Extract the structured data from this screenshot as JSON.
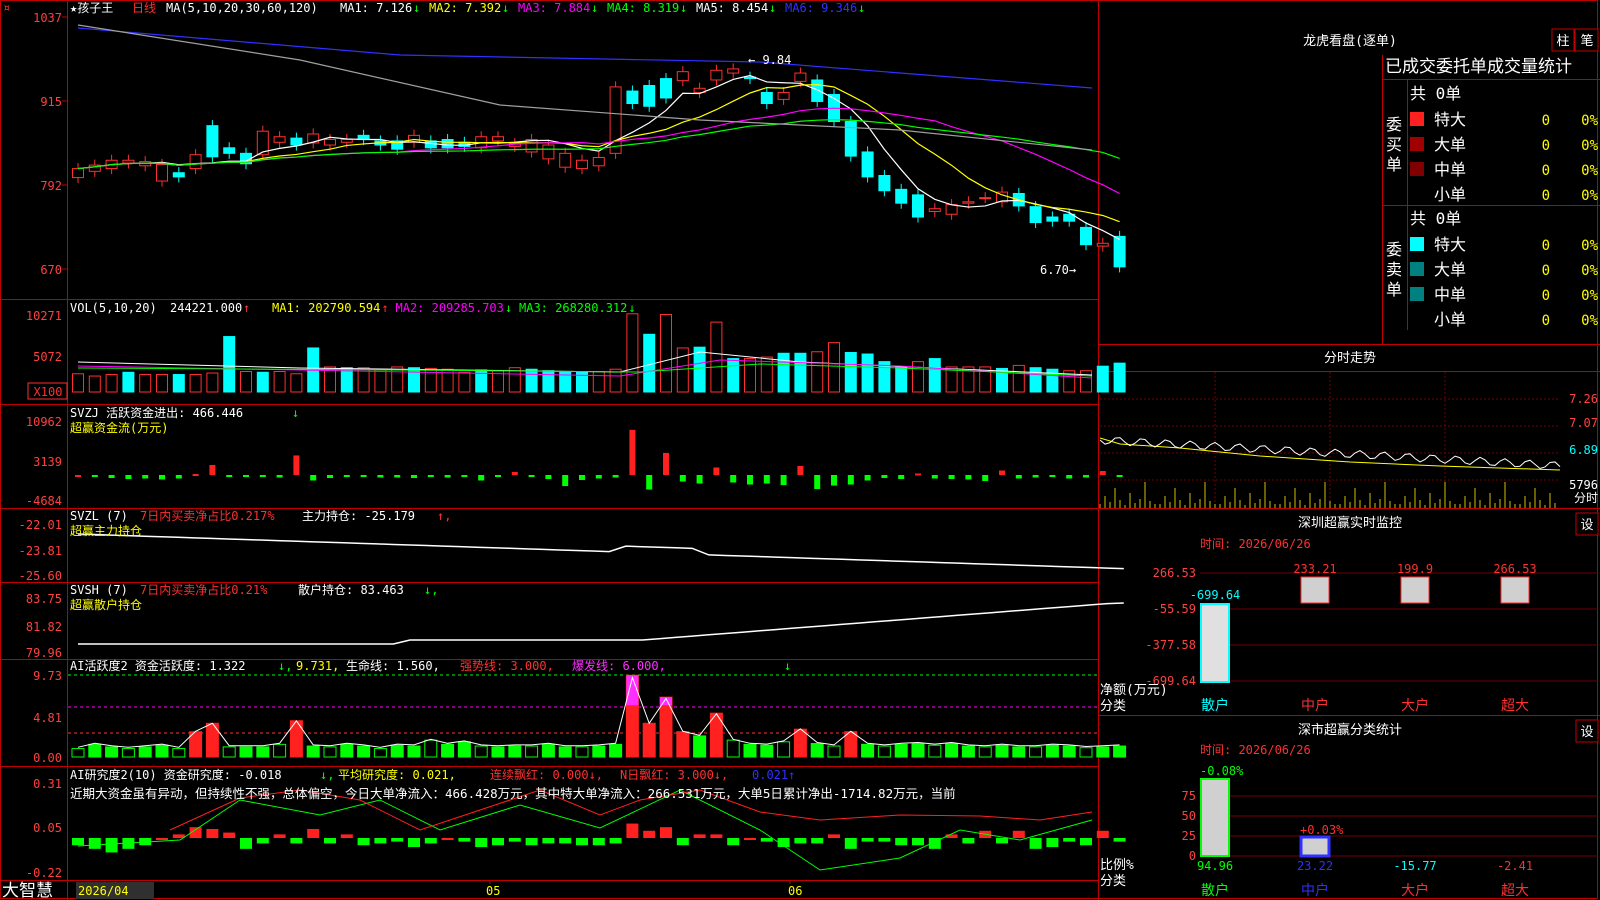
{
  "chart_data": [
    {
      "type": "candlestick",
      "title": "孩子王日线",
      "indicator": "MA(5,10,20,30,60,120)",
      "y_ticks": [
        "1037",
        "915",
        "792",
        "670"
      ],
      "ylim": [
        640,
        1040
      ],
      "ma_values": [
        {
          "name": "MA1",
          "value": "7.126",
          "arrow": "↓"
        },
        {
          "name": "MA2",
          "value": "7.392",
          "arrow": "↓"
        },
        {
          "name": "MA3",
          "value": "7.884",
          "arrow": "↓"
        },
        {
          "name": "MA4",
          "value": "8.319",
          "arrow": "↓"
        },
        {
          "name": "MA5",
          "value": "8.454",
          "arrow": "↓"
        },
        {
          "name": "MA6",
          "value": "9.346",
          "arrow": "↓"
        }
      ],
      "annotations": [
        "9.84",
        "6.70"
      ],
      "candles": [
        [
          805,
          818
        ],
        [
          814,
          823
        ],
        [
          818,
          830
        ],
        [
          826,
          830
        ],
        [
          822,
          828
        ],
        [
          800,
          824
        ],
        [
          812,
          806
        ],
        [
          818,
          838
        ],
        [
          880,
          835
        ],
        [
          848,
          840
        ],
        [
          840,
          825
        ],
        [
          838,
          872
        ],
        [
          856,
          864
        ],
        [
          862,
          852
        ],
        [
          855,
          868
        ],
        [
          852,
          860
        ],
        [
          856,
          860
        ],
        [
          866,
          860
        ],
        [
          858,
          852
        ],
        [
          858,
          846
        ],
        [
          856,
          866
        ],
        [
          858,
          848
        ],
        [
          860,
          848
        ],
        [
          856,
          850
        ],
        [
          848,
          864
        ],
        [
          858,
          864
        ],
        [
          850,
          854
        ],
        [
          842,
          860
        ],
        [
          832,
          852
        ],
        [
          820,
          840
        ],
        [
          818,
          830
        ],
        [
          822,
          834
        ],
        [
          840,
          936
        ],
        [
          930,
          912
        ],
        [
          938,
          908
        ],
        [
          948,
          920
        ],
        [
          945,
          958
        ],
        [
          928,
          934
        ],
        [
          946,
          960
        ],
        [
          956,
          962
        ],
        [
          950,
          948
        ],
        [
          928,
          912
        ],
        [
          918,
          928
        ],
        [
          944,
          956
        ],
        [
          946,
          915
        ],
        [
          925,
          886
        ],
        [
          886,
          836
        ],
        [
          842,
          806
        ],
        [
          808,
          786
        ],
        [
          788,
          768
        ],
        [
          780,
          748
        ],
        [
          756,
          760
        ],
        [
          752,
          766
        ],
        [
          768,
          770
        ],
        [
          776,
          776
        ],
        [
          770,
          784
        ],
        [
          782,
          764
        ],
        [
          763,
          740
        ],
        [
          748,
          742
        ],
        [
          752,
          742
        ],
        [
          733,
          708
        ],
        [
          706,
          710
        ],
        [
          720,
          676
        ]
      ]
    },
    {
      "type": "bar",
      "title": "VOL(5,10,20)",
      "values_header": "244221.000",
      "ma": [
        {
          "name": "MA1",
          "value": "202790.594",
          "arrow": "↑"
        },
        {
          "name": "MA2",
          "value": "209285.703",
          "arrow": "↓"
        },
        {
          "name": "MA3",
          "value": "268280.312",
          "arrow": "↓"
        }
      ],
      "y_ticks": [
        "10271",
        "5072"
      ],
      "unit": "X100",
      "values": [
        2400,
        2100,
        2300,
        2600,
        2300,
        2300,
        2300,
        2300,
        2500,
        7300,
        2700,
        2600,
        2700,
        2400,
        5800,
        3300,
        3200,
        3200,
        2900,
        3300,
        3200,
        3100,
        3000,
        2600,
        2900,
        2800,
        3200,
        3000,
        2800,
        2700,
        2700,
        2700,
        3000,
        10300,
        7600,
        10200,
        5800,
        5900,
        9200,
        4400,
        4400,
        4600,
        5100,
        5100,
        5300,
        6500,
        5200,
        5000,
        4000,
        3300,
        4000,
        4400,
        3300,
        3300,
        3300,
        3100,
        3500,
        3200,
        3000,
        2800,
        2800,
        3400,
        3800
      ],
      "up": [
        1,
        1,
        1,
        0,
        1,
        1,
        0,
        1,
        1,
        0,
        1,
        0,
        1,
        1,
        0,
        1,
        0,
        1,
        1,
        1,
        0,
        1,
        1,
        1,
        0,
        1,
        1,
        0,
        0,
        0,
        0,
        1,
        1,
        1,
        0,
        1,
        1,
        0,
        1,
        0,
        1,
        1,
        0,
        0,
        1,
        1,
        0,
        0,
        0,
        0,
        1,
        0,
        1,
        1,
        1,
        0,
        1,
        0,
        0,
        1,
        1,
        0,
        0
      ]
    },
    {
      "type": "bar",
      "title": "SVZJ",
      "label": "活跃资金进出:",
      "value": "466.446",
      "arrow": "↓",
      "subtitle": "超赢资金流(万元)",
      "y_ticks": [
        "10962",
        "3139",
        "-4684"
      ],
      "values": [
        0,
        -400,
        -600,
        -800,
        -700,
        -900,
        -700,
        200,
        2000,
        -300,
        -400,
        -300,
        -500,
        3900,
        -1100,
        -600,
        -300,
        -400,
        -500,
        -500,
        -600,
        -300,
        -500,
        -200,
        -1100,
        -400,
        600,
        -300,
        -800,
        -2200,
        -1000,
        -700,
        -500,
        9000,
        -2900,
        4400,
        -1300,
        -1700,
        1500,
        -1500,
        -1900,
        -1700,
        -2000,
        1800,
        -2800,
        -2100,
        -1900,
        -1100,
        -600,
        -800,
        300,
        -700,
        -800,
        -900,
        -1200,
        900,
        -700,
        -500,
        -200,
        -700,
        -500,
        800,
        -300
      ]
    },
    {
      "type": "line",
      "title": "SVZL (7)",
      "label": "7日内买卖净占比0.217%",
      "label2": "主力持仓:",
      "value": "-25.179",
      "arrow": "↑",
      "subtitle": "超赢主力持仓",
      "y_ticks": [
        "-22.01",
        "-23.81",
        "-25.60"
      ]
    },
    {
      "type": "line",
      "title": "SVSH (7)",
      "label": "7日内买卖净占比0.21%",
      "label2": "散户持仓:",
      "value": "83.463",
      "arrow": "↓",
      "subtitle": "超赢散户持仓",
      "y_ticks": [
        "83.75",
        "81.82",
        "79.96"
      ]
    },
    {
      "type": "bar",
      "title": "AI活跃度2",
      "label": "资金活跃度:",
      "value": "1.322",
      "arrow1": "↓",
      "value2": "9.731",
      "label3": "生命线:",
      "value3": "1.560",
      "label4": "强势线:",
      "value4": "3.000",
      "label5": "爆发线:",
      "value5": "6.000",
      "y_ticks": [
        "9.73",
        "4.81",
        "0.00"
      ]
    },
    {
      "type": "bar",
      "title": "AI研究度2(10)",
      "label": "资金研究度:",
      "value": "-0.018",
      "arrow1": "↓",
      "label2": "平均研究度:",
      "value2": "0.021",
      "label3": "连续飘红:",
      "value3": "0.000",
      "label4": "N日飘红:",
      "value4": "3.000",
      "value5": "0.021",
      "y_ticks": [
        "0.31",
        "0.05",
        "-0.22"
      ],
      "comment": "近期大资金虽有异动，但持续性不强，总体偏空，今日大单净流入：466.428万元，其中特大单净流入：266.531万元，大单5日累计净出-1714.82万元，当前"
    }
  ],
  "bottom": {
    "brand": "大智慧",
    "dates": [
      "2026/04",
      "05",
      "06"
    ]
  },
  "right": {
    "title": "龙虎看盘(逐单)",
    "btn1": "柱",
    "btn2": "笔",
    "section_title": "已成交委托单成交量统计",
    "buy": {
      "label": "委买单",
      "total": "共 0单",
      "rows": [
        {
          "name": "特大",
          "value": "0",
          "pct": "0%"
        },
        {
          "name": "大单",
          "value": "0",
          "pct": "0%"
        },
        {
          "name": "中单",
          "value": "0",
          "pct": "0%"
        },
        {
          "name": "小单",
          "value": "0",
          "pct": "0%"
        }
      ]
    },
    "sell": {
      "label": "委卖单",
      "total": "共 0单",
      "rows": [
        {
          "name": "特大",
          "value": "0",
          "pct": "0%"
        },
        {
          "name": "大单",
          "value": "0",
          "pct": "0%"
        },
        {
          "name": "中单",
          "value": "0",
          "pct": "0%"
        },
        {
          "name": "小单",
          "value": "0",
          "pct": "0%"
        }
      ]
    },
    "fenshi": {
      "title": "分时走势",
      "ticks": [
        "7.26",
        "7.07",
        "6.89",
        "5796"
      ],
      "bottom": "分时"
    },
    "monitor": {
      "title": "深圳超赢实时监控",
      "btn": "设",
      "time": "时间: 2026/06/26",
      "ticks": [
        "266.53",
        "-55.59",
        "-377.58",
        "-699.64"
      ],
      "ylabel": "净额(万元)",
      "xlabel": "分类",
      "bars": [
        {
          "name": "散户",
          "value": "-699.64"
        },
        {
          "name": "中户",
          "value": "233.21"
        },
        {
          "name": "大户",
          "value": "199.9"
        },
        {
          "name": "超大",
          "value": "266.53"
        }
      ]
    },
    "stats": {
      "title": "深市超赢分类统计",
      "btn": "设",
      "time": "时间: 2026/06/26",
      "ticks": [
        "75",
        "50",
        "25",
        "0"
      ],
      "ylabel": "比例%",
      "xlabel": "分类",
      "top": [
        "-0.08%",
        "+0.03%"
      ],
      "bars": [
        {
          "name": "散户",
          "value": "94.96"
        },
        {
          "name": "中户",
          "value": "23.22"
        },
        {
          "name": "大户",
          "value": "-15.77"
        },
        {
          "name": "超大",
          "value": "-2.41"
        }
      ]
    }
  }
}
